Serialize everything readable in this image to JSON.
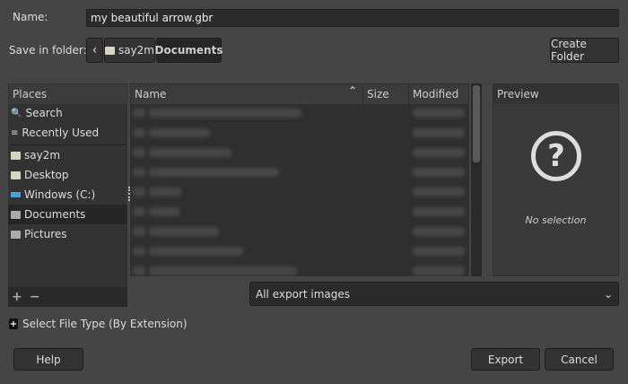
{
  "name_label": "Name:",
  "name_value": "my beautiful arrow.gbr",
  "folder_label": "Save in folder:",
  "path": [
    "say2m",
    "Documents"
  ],
  "create_folder": "Create Folder",
  "places": {
    "header": "Places",
    "items": [
      {
        "label": "Search",
        "icon": "search-icon"
      },
      {
        "label": "Recently Used",
        "icon": "recent-icon"
      },
      {
        "label": "say2m",
        "icon": "folder-icon"
      },
      {
        "label": "Desktop",
        "icon": "folder-icon"
      },
      {
        "label": "Windows (C:)",
        "icon": "drive-icon"
      },
      {
        "label": "Documents",
        "icon": "folder-icon"
      },
      {
        "label": "Pictures",
        "icon": "folder-icon"
      }
    ],
    "add": "+",
    "remove": "−"
  },
  "files": {
    "columns": [
      "Name",
      "Size",
      "Modified"
    ],
    "sort_indicator": "^"
  },
  "preview": {
    "header": "Preview",
    "empty": "No selection"
  },
  "filter": "All export images",
  "file_type_expander": "Select File Type (By Extension)",
  "buttons": {
    "help": "Help",
    "export": "Export",
    "cancel": "Cancel"
  }
}
